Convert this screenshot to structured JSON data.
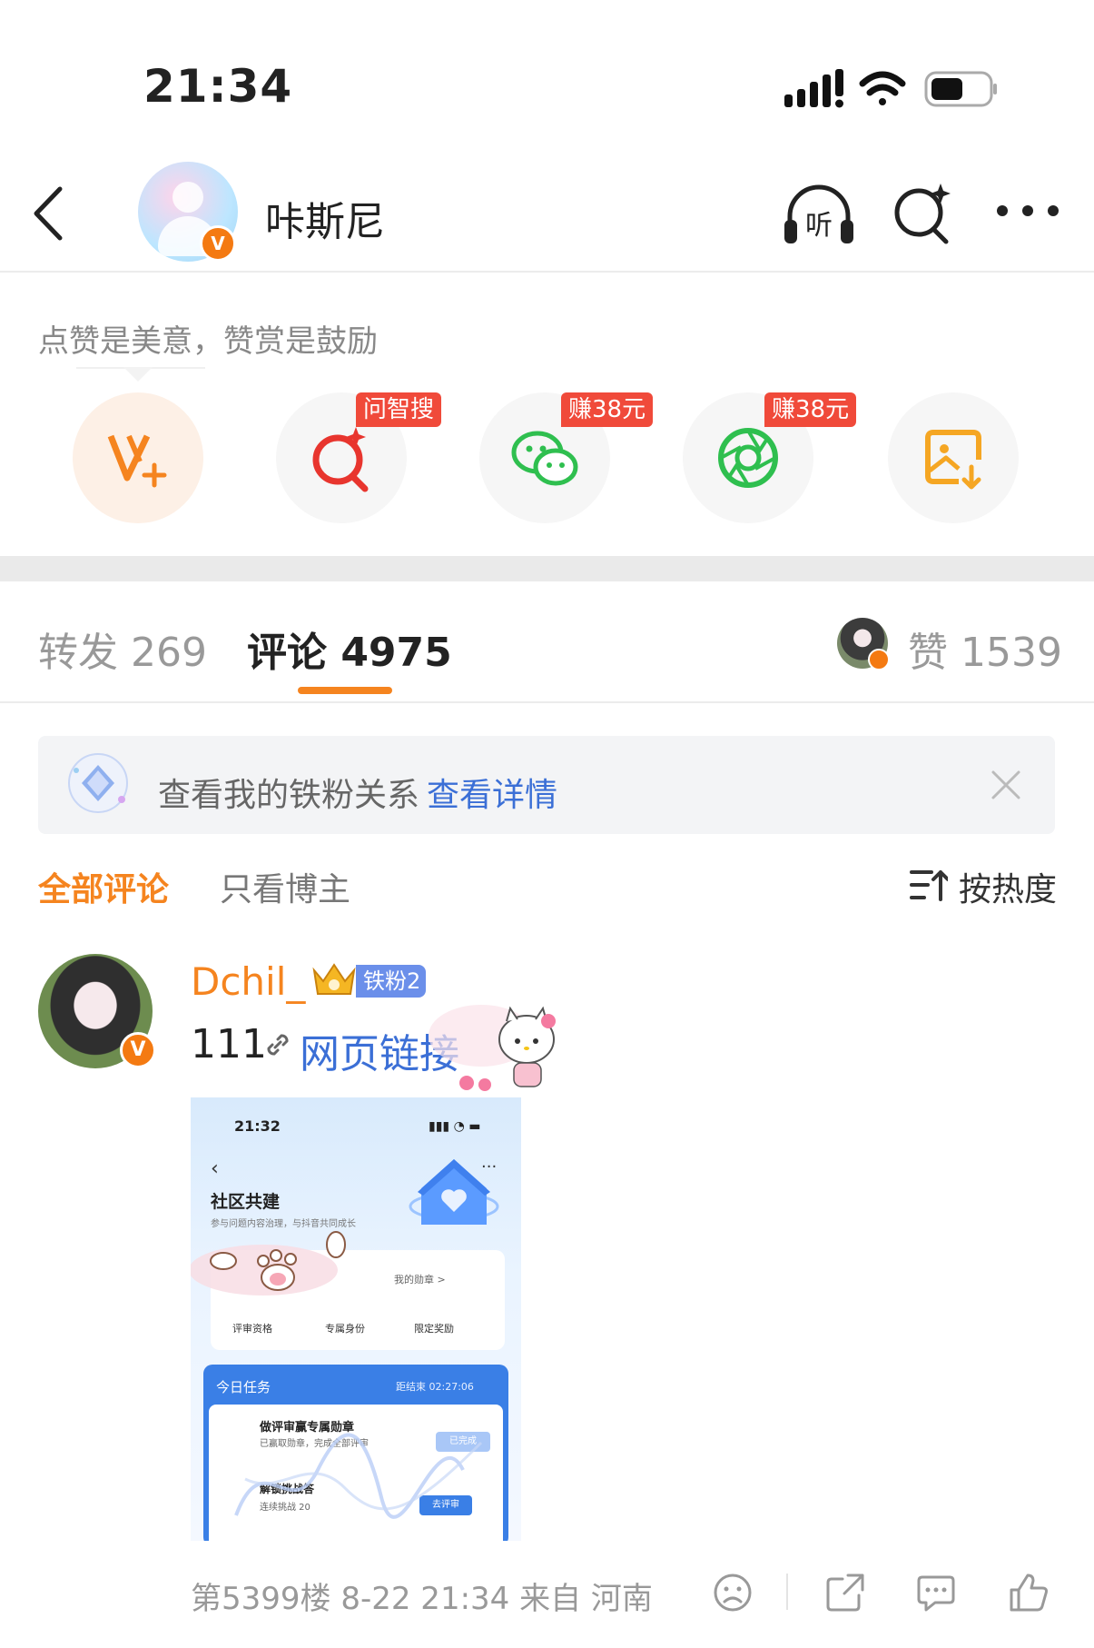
{
  "status_bar": {
    "time": "21:34"
  },
  "header": {
    "username": "咔斯尼",
    "verified_badge": "V"
  },
  "share": {
    "tip": "点赞是美意，赞赏是鼓励",
    "items": [
      {
        "icon": "vplus-icon",
        "tag": ""
      },
      {
        "icon": "smart-search-icon",
        "tag": "问智搜"
      },
      {
        "icon": "wechat-icon",
        "tag": "赚38元"
      },
      {
        "icon": "moments-icon",
        "tag": "赚38元"
      },
      {
        "icon": "save-image-icon",
        "tag": ""
      }
    ]
  },
  "tabs": {
    "repost": "转发 269",
    "comment": "评论 4975",
    "like": "赞 1539"
  },
  "fan_banner": {
    "text": "查看我的铁粉关系",
    "link": "查看详情"
  },
  "filters": {
    "all": "全部评论",
    "owner_only": "只看博主",
    "sort": "按热度"
  },
  "comment": {
    "username": "Dchil_",
    "fan_badge": "铁粉2",
    "text": "111",
    "link_text": "网页链接",
    "meta": "第5399楼 8-22 21:34 来自 河南",
    "image": {
      "time": "21:32",
      "title": "社区共建",
      "subtitle": "参与问题内容治理，与抖音共同成长",
      "my_badge": "我的勋章 >",
      "perks": [
        "评审资格",
        "专属身份",
        "限定奖励"
      ],
      "task_title": "今日任务",
      "task_time": "距结束 02:27:06",
      "task1": "做评审赢专属勋章",
      "task1_sub": "已赢取勋章，完成全部评审",
      "task1_btn": "已完成",
      "task2": "解锁挑战答",
      "task2_sub": "连续挑战 20",
      "task2_btn": "去评审"
    }
  },
  "colors": {
    "accent": "#f5841f",
    "link": "#3b6fd6",
    "tag_red": "#f04a3a"
  }
}
